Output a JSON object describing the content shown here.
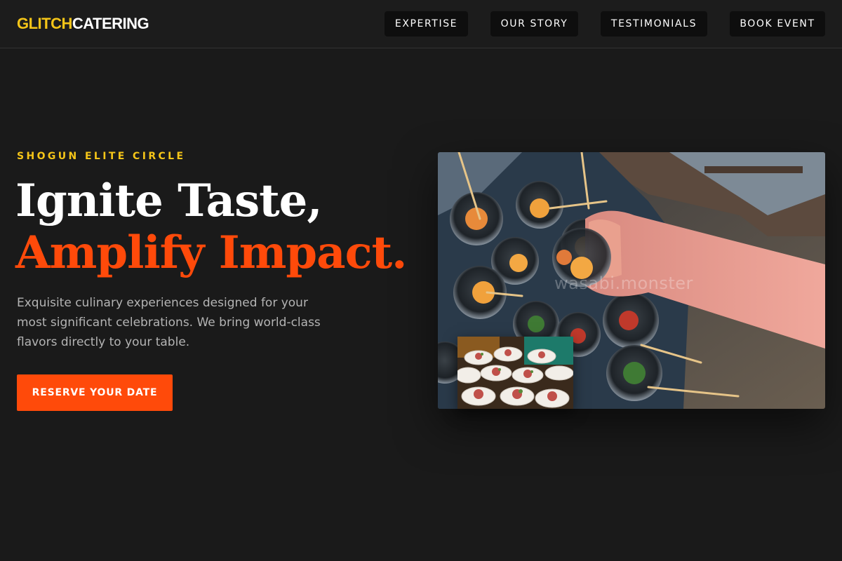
{
  "header": {
    "logo_accent": "GLITCH",
    "logo_main": "CATERING",
    "nav": [
      {
        "label": "EXPERTISE"
      },
      {
        "label": "OUR STORY"
      },
      {
        "label": "TESTIMONIALS"
      },
      {
        "label": "BOOK EVENT"
      }
    ]
  },
  "hero": {
    "eyebrow": "SHOGUN ELITE CIRCLE",
    "headline_line1": "Ignite Taste,",
    "headline_line2": "Amplify Impact.",
    "description": "Exquisite culinary experiences designed for your most significant celebrations. We bring world-class flavors directly to your table.",
    "cta_label": "RESERVE YOUR DATE",
    "image_watermark": "wasabi.monster"
  },
  "colors": {
    "background": "#1a1a1a",
    "accent_yellow": "#f5c518",
    "accent_orange": "#ff4a0a",
    "nav_button": "#0e0e0e",
    "body_text": "#b4b4b4"
  }
}
